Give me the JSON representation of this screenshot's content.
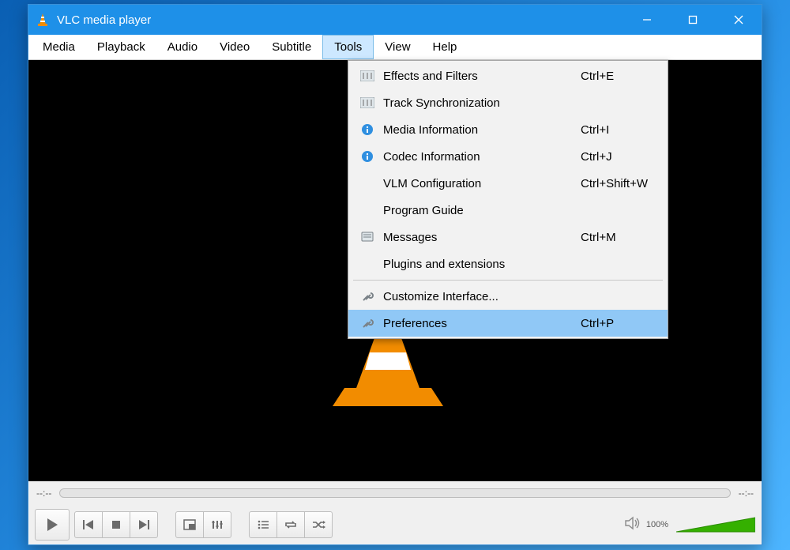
{
  "window": {
    "title": "VLC media player"
  },
  "menubar": [
    "Media",
    "Playback",
    "Audio",
    "Video",
    "Subtitle",
    "Tools",
    "View",
    "Help"
  ],
  "menubar_active_index": 5,
  "tools_menu": {
    "groups": [
      [
        {
          "icon": "equalizer",
          "label": "Effects and Filters",
          "shortcut": "Ctrl+E"
        },
        {
          "icon": "equalizer",
          "label": "Track Synchronization",
          "shortcut": ""
        },
        {
          "icon": "info",
          "label": "Media Information",
          "shortcut": "Ctrl+I"
        },
        {
          "icon": "info",
          "label": "Codec Information",
          "shortcut": "Ctrl+J"
        },
        {
          "icon": "",
          "label": "VLM Configuration",
          "shortcut": "Ctrl+Shift+W"
        },
        {
          "icon": "",
          "label": "Program Guide",
          "shortcut": ""
        },
        {
          "icon": "messages",
          "label": "Messages",
          "shortcut": "Ctrl+M"
        },
        {
          "icon": "",
          "label": "Plugins and extensions",
          "shortcut": ""
        }
      ],
      [
        {
          "icon": "wrench",
          "label": "Customize Interface...",
          "shortcut": ""
        },
        {
          "icon": "wrench",
          "label": "Preferences",
          "shortcut": "Ctrl+P",
          "highlight": true
        }
      ]
    ]
  },
  "seek": {
    "elapsed": "--:--",
    "total": "--:--"
  },
  "volume": {
    "label": "100%"
  }
}
